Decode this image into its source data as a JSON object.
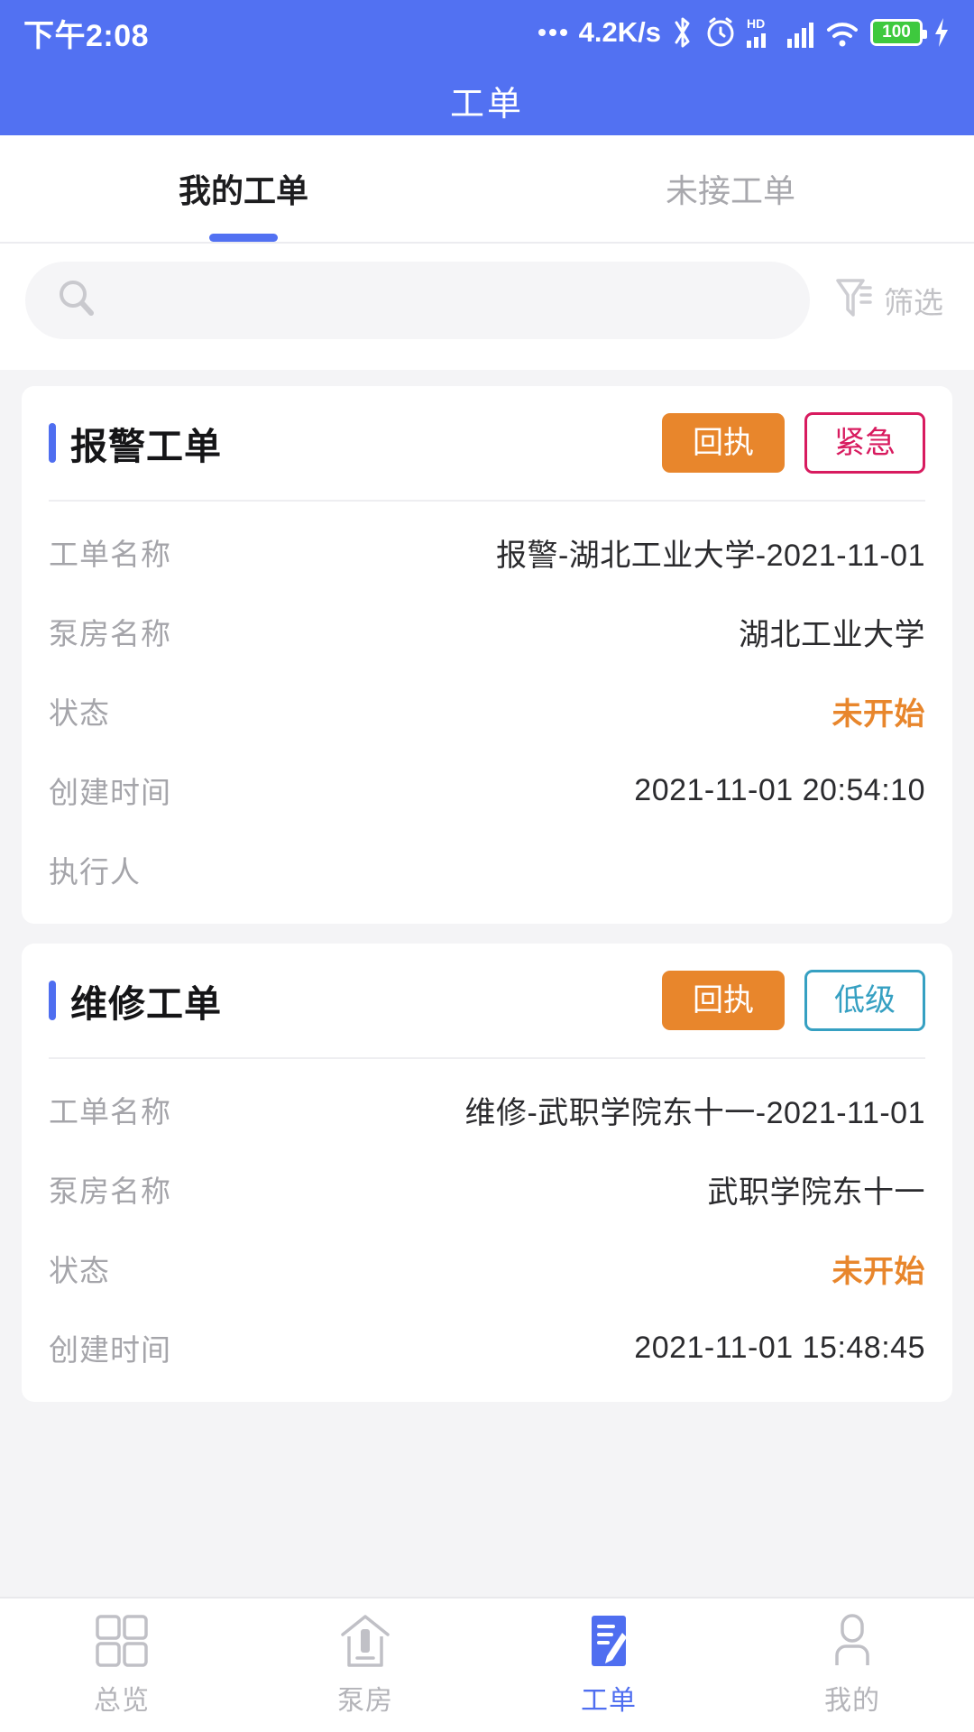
{
  "status_bar": {
    "time": "下午2:08",
    "net_speed": "4.2K/s",
    "battery_level": "100",
    "icons": [
      "dots-icon",
      "bluetooth-icon",
      "alarm-icon",
      "hd-icon",
      "signal-icon",
      "wifi-icon",
      "battery-icon",
      "charging-bolt-icon"
    ]
  },
  "app_bar": {
    "title": "工单"
  },
  "tabs": [
    {
      "label": "我的工单",
      "active": true
    },
    {
      "label": "未接工单",
      "active": false
    }
  ],
  "search": {
    "value": "",
    "placeholder": "",
    "icon": "search-icon"
  },
  "filter": {
    "label": "筛选",
    "icon": "filter-icon"
  },
  "cards": [
    {
      "title": "报警工单",
      "receipt_label": "回执",
      "priority": {
        "label": "紧急",
        "level": "urgent",
        "color": "#d81b5f"
      },
      "rows": [
        {
          "label": "工单名称",
          "value": "报警-湖北工业大学-2021-11-01"
        },
        {
          "label": "泵房名称",
          "value": "湖北工业大学"
        },
        {
          "label": "状态",
          "value": "未开始",
          "highlight": true
        },
        {
          "label": "创建时间",
          "value": "2021-11-01 20:54:10"
        },
        {
          "label": "执行人",
          "value": ""
        }
      ]
    },
    {
      "title": "维修工单",
      "receipt_label": "回执",
      "priority": {
        "label": "低级",
        "level": "low",
        "color": "#36a0c2"
      },
      "rows": [
        {
          "label": "工单名称",
          "value": "维修-武职学院东十一-2021-11-01"
        },
        {
          "label": "泵房名称",
          "value": "武职学院东十一"
        },
        {
          "label": "状态",
          "value": "未开始",
          "highlight": true
        },
        {
          "label": "创建时间",
          "value": "2021-11-01 15:48:45"
        }
      ]
    }
  ],
  "bottom_nav": [
    {
      "label": "总览",
      "icon": "grid-icon",
      "active": false
    },
    {
      "label": "泵房",
      "icon": "pumphouse-icon",
      "active": false
    },
    {
      "label": "工单",
      "icon": "worksheet-edit-icon",
      "active": true
    },
    {
      "label": "我的",
      "icon": "person-icon",
      "active": false
    }
  ],
  "colors": {
    "brand_blue": "#5271f2",
    "accent_orange": "#e8862c",
    "urgent_red": "#d81b5f",
    "low_cyan": "#36a0c2",
    "status_orange": "#e8862c"
  }
}
